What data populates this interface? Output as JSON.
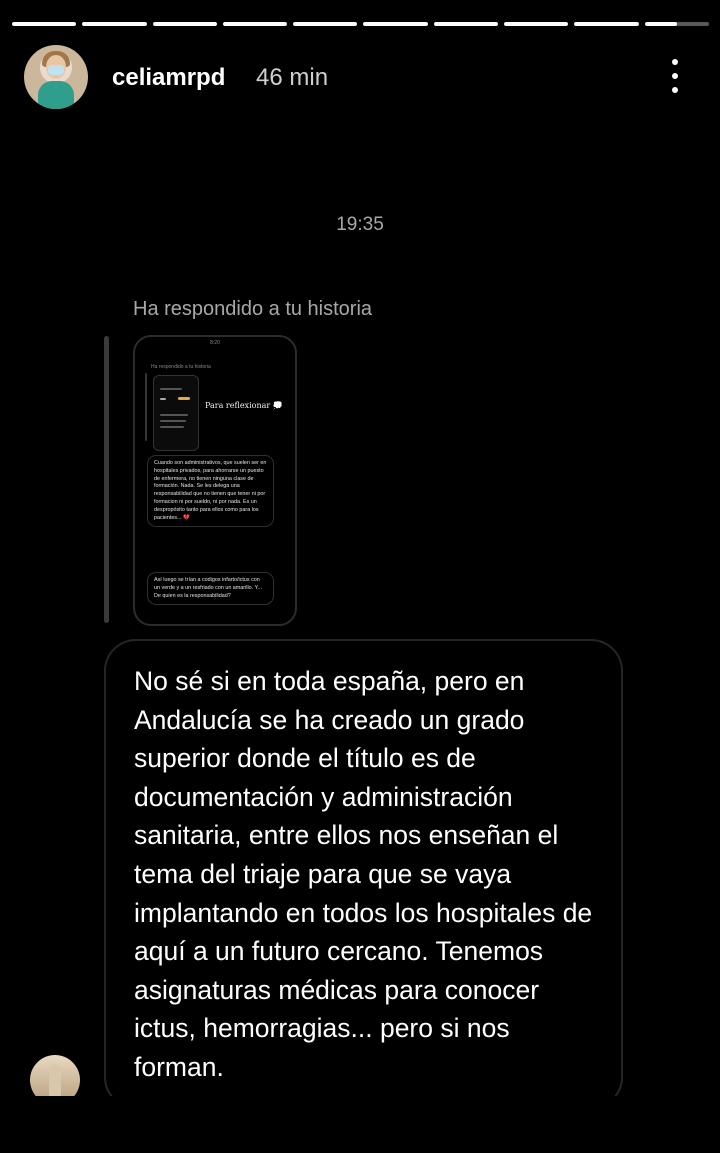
{
  "progress": {
    "segments_total": 10,
    "completed": 9,
    "current_fraction": 0.5
  },
  "header": {
    "username": "celiamrpd",
    "time_ago": "46 min"
  },
  "chat": {
    "timestamp": "19:35",
    "reply_label": "Ha respondido a tu historia",
    "story_preview": {
      "time": "8:20",
      "label": "Ha respondido a tu historia",
      "caption": "Para reflexionar 💭",
      "bubble1": "Cuando son administrativos, que suelen ser en hospitales privados, para ahorrarse un puesto de enfermera, no tienen ninguna clase de formación. Nada. Se les delega una responsabilidad que no tienen que tener ni por formacion ni por sueldo, ni por nada. Es un despropósito tanto para ellos como para los pacientes...",
      "bubble1_heart": "💔",
      "bubble2": "Así luego se trían a codigos infarto/ictus con un verde y a un resfriado con un amarillo. Y... De quien es la responsabilidad?"
    },
    "message": "No sé si en toda españa, pero en Andalucía se ha creado un grado superior donde el título es de documentación y administración sanitaria, entre ellos nos enseñan el tema del triaje para que se vaya implantando en todos los hospitales de aquí a un futuro cercano. Tenemos asignaturas médicas para conocer ictus, hemorragias... pero si nos forman."
  },
  "icons": {
    "more": "more-vertical-icon"
  }
}
